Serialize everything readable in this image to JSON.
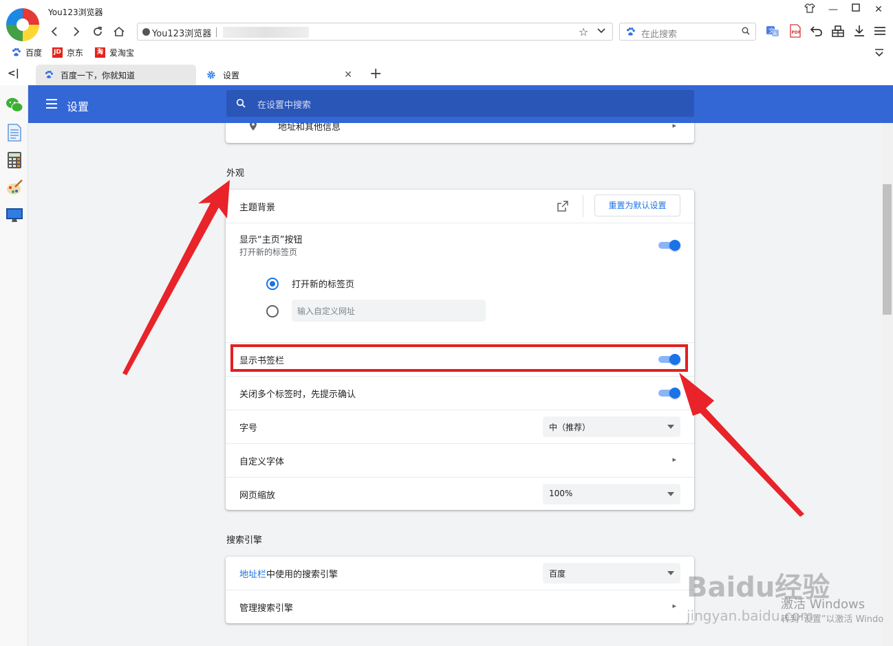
{
  "window": {
    "title": "You123浏览器"
  },
  "address_bar": {
    "site_label": "You123浏览器"
  },
  "search_box": {
    "placeholder": "在此搜索"
  },
  "bookmarks": [
    {
      "label": "百度",
      "icon": "baidu-paw-icon"
    },
    {
      "label": "京东",
      "icon": "jd-icon",
      "icon_text": "JD"
    },
    {
      "label": "爱淘宝",
      "icon": "taobao-icon",
      "icon_text": "淘"
    }
  ],
  "tabs": [
    {
      "label": "百度一下，你就知道",
      "icon": "baidu-paw-icon",
      "active": false
    },
    {
      "label": "设置",
      "icon": "gear-icon",
      "active": true
    }
  ],
  "settings": {
    "header_title": "设置",
    "search_placeholder": "在设置中搜索",
    "prev_row_label": "地址和其他信息",
    "appearance": {
      "section_title": "外观",
      "theme_label": "主题背景",
      "reset_button": "重置为默认设置",
      "home_button_label": "显示“主页”按钮",
      "home_button_sub": "打开新的标签页",
      "home_button_on": true,
      "radio_new_tab": "打开新的标签页",
      "radio_custom_placeholder": "输入自定义网址",
      "bookmark_bar_label": "显示书签栏",
      "bookmark_bar_on": true,
      "close_confirm_label": "关闭多个标签时，先提示确认",
      "close_confirm_on": true,
      "font_size_label": "字号",
      "font_size_value": "中（推荐）",
      "custom_font_label": "自定义字体",
      "zoom_label": "网页缩放",
      "zoom_value": "100%"
    },
    "search_engine": {
      "section_title": "搜索引擎",
      "engine_link": "地址栏",
      "engine_label_rest": "中使用的搜索引擎",
      "engine_value": "百度",
      "manage_label": "管理搜索引擎"
    }
  },
  "watermark": {
    "baidu": "Baidu经验",
    "url": "jingyan.baidu.com",
    "activate_title": "激活 Windows",
    "activate_sub": "转到“设置”以激活 Windo"
  },
  "colors": {
    "header": "#3367d6",
    "accent": "#1a73e8",
    "annotation": "#e02020"
  }
}
